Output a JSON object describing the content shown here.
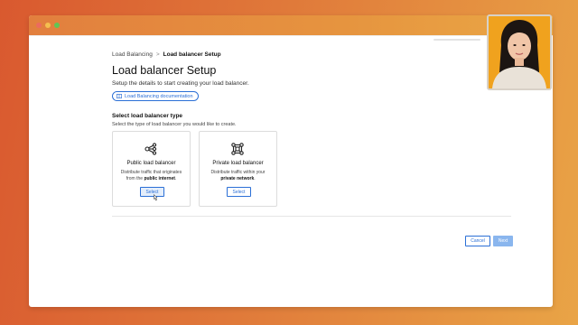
{
  "window": {
    "controls": [
      "close",
      "minimize",
      "maximize"
    ]
  },
  "breadcrumb": {
    "parent": "Load Balancing",
    "separator": ">",
    "current": "Load balancer Setup"
  },
  "page": {
    "title": "Load balancer Setup",
    "subtitle": "Setup the details to start creating your load balancer.",
    "doc_link": "Load Balancing documentation"
  },
  "section": {
    "title": "Select load balancer type",
    "description": "Select the type of load balancer you would like to create."
  },
  "cards": [
    {
      "title": "Public load balancer",
      "desc_prefix": "Distribute traffic that originates from the",
      "desc_bold": "public internet",
      "desc_suffix": ".",
      "button": "Select",
      "icon": "share-nodes-icon"
    },
    {
      "title": "Private load balancer",
      "desc_prefix": "Distribute traffic within your",
      "desc_bold": "private network",
      "desc_suffix": ".",
      "button": "Select",
      "icon": "network-icon"
    }
  ],
  "footer": {
    "cancel": "Cancel",
    "next": "Next"
  },
  "colors": {
    "accent": "#2b6fd6",
    "accent_disabled": "#8ab6ee",
    "background_start": "#d9592f",
    "background_end": "#e9a446"
  }
}
